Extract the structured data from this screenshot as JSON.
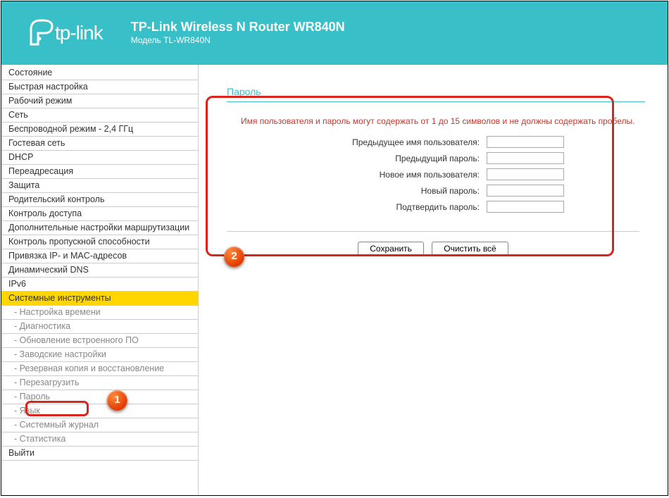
{
  "header": {
    "brand": "tp-link",
    "title": "TP-Link Wireless N Router WR840N",
    "model": "Модель TL-WR840N"
  },
  "sidebar": {
    "items": [
      {
        "label": "Состояние",
        "sub": false
      },
      {
        "label": "Быстрая настройка",
        "sub": false
      },
      {
        "label": "Рабочий режим",
        "sub": false
      },
      {
        "label": "Сеть",
        "sub": false
      },
      {
        "label": "Беспроводной режим - 2,4 ГГц",
        "sub": false
      },
      {
        "label": "Гостевая сеть",
        "sub": false
      },
      {
        "label": "DHCP",
        "sub": false
      },
      {
        "label": "Переадресация",
        "sub": false
      },
      {
        "label": "Защита",
        "sub": false
      },
      {
        "label": "Родительский контроль",
        "sub": false
      },
      {
        "label": "Контроль доступа",
        "sub": false
      },
      {
        "label": "Дополнительные настройки маршрутизации",
        "sub": false
      },
      {
        "label": "Контроль пропускной способности",
        "sub": false
      },
      {
        "label": "Привязка IP- и MAC-адресов",
        "sub": false
      },
      {
        "label": "Динамический DNS",
        "sub": false
      },
      {
        "label": "IPv6",
        "sub": false
      },
      {
        "label": "Системные инструменты",
        "sub": false,
        "active": true
      },
      {
        "label": "- Настройка времени",
        "sub": true
      },
      {
        "label": "- Диагностика",
        "sub": true
      },
      {
        "label": "- Обновление встроенного ПО",
        "sub": true
      },
      {
        "label": "- Заводские настройки",
        "sub": true
      },
      {
        "label": "- Резервная копия и восстановление",
        "sub": true
      },
      {
        "label": "- Перезагрузить",
        "sub": true
      },
      {
        "label": "- Пароль",
        "sub": true
      },
      {
        "label": "- Язык",
        "sub": true
      },
      {
        "label": "- Системный журнал",
        "sub": true
      },
      {
        "label": "- Статистика",
        "sub": true
      },
      {
        "label": "Выйти",
        "sub": false
      }
    ]
  },
  "content": {
    "section_title": "Пароль",
    "warning": "Имя пользователя и пароль могут содержать от 1 до 15 символов и не должны содержать пробелы.",
    "fields": {
      "old_user": "Предыдущее имя пользователя:",
      "old_pass": "Предыдущий пароль:",
      "new_user": "Новое имя пользователя:",
      "new_pass": "Новый пароль:",
      "confirm_pass": "Подтвердить пароль:"
    },
    "buttons": {
      "save": "Сохранить",
      "clear": "Очистить всё"
    }
  },
  "markers": {
    "m1": "1",
    "m2": "2"
  }
}
